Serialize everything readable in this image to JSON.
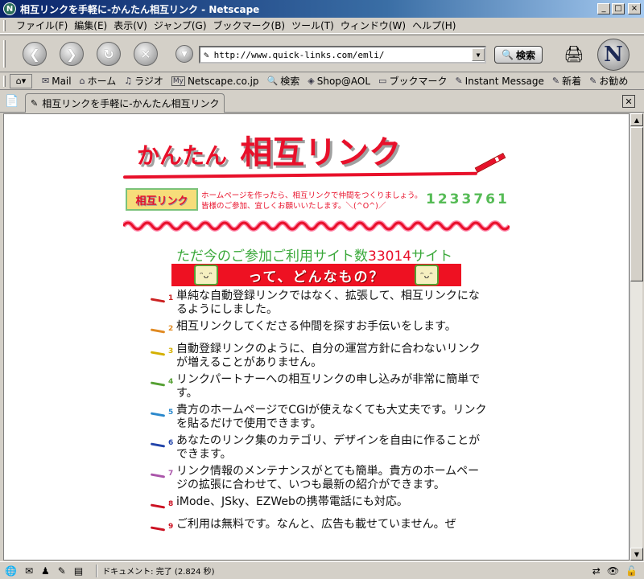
{
  "window": {
    "title": "相互リンクを手軽に-かんたん相互リンク - Netscape",
    "app_icon": "N",
    "min": "_",
    "max": "□",
    "close": "×"
  },
  "menu": [
    "ファイル(F)",
    "編集(E)",
    "表示(V)",
    "ジャンプ(G)",
    "ブックマーク(B)",
    "ツール(T)",
    "ウィンドウ(W)",
    "ヘルプ(H)"
  ],
  "nav": {
    "url": "http://www.quick-links.com/emli/",
    "search_label": "検索",
    "logo": "N"
  },
  "personal_toolbar": [
    {
      "icon": "✉",
      "label": "Mail"
    },
    {
      "icon": "⌂",
      "label": "ホーム"
    },
    {
      "icon": "♫",
      "label": "ラジオ"
    },
    {
      "icon": "My",
      "label": "Netscape.co.jp"
    },
    {
      "icon": "🔍",
      "label": "検索"
    },
    {
      "icon": "◈",
      "label": "Shop@AOL"
    },
    {
      "icon": "▭",
      "label": "ブックマーク"
    },
    {
      "icon": "✎",
      "label": "Instant Message"
    },
    {
      "icon": "✎",
      "label": "新着"
    },
    {
      "icon": "✎",
      "label": "お勧め"
    }
  ],
  "tab": {
    "title": "相互リンクを手軽に-かんたん相互リンク"
  },
  "page": {
    "title_small": "かんたん",
    "title_big": "相互リンク",
    "mini_logo": "相互リンク",
    "intro": "ホームページを作ったら、相互リンクで仲間をつくりましょう。皆様のご参加、宜しくお願いいたします。＼(^O^)／",
    "counter": "1233761",
    "count_prefix": "ただ今のご参加ご利用サイト数",
    "count_number": "33014",
    "count_suffix": "サイト",
    "banner": "って、どんなもの？",
    "features": [
      {
        "n": "1",
        "color": "#cc2222",
        "text": "単純な自動登録リンクではなく、拡張して、相互リンクになるようにしました。"
      },
      {
        "n": "2",
        "color": "#e08a22",
        "text": "相互リンクしてくださる仲間を探すお手伝いをします。"
      },
      {
        "n": "3",
        "color": "#d4b000",
        "text": "自動登録リンクのように、自分の運営方針に合わないリンクが増えることがありません。"
      },
      {
        "n": "4",
        "color": "#55a033",
        "text": "リンクパートナーへの相互リンクの申し込みが非常に簡単です。"
      },
      {
        "n": "5",
        "color": "#2a88cc",
        "text": "貴方のホームページでCGIが使えなくても大丈夫です。リンクを貼るだけで使用できます。"
      },
      {
        "n": "6",
        "color": "#2244aa",
        "text": "あなたのリンク集のカテゴリ、デザインを自由に作ることができます。"
      },
      {
        "n": "7",
        "color": "#aa55aa",
        "text": "リンク情報のメンテナンスがとても簡単。貴方のホームページの拡張に合わせて、いつも最新の紹介ができます。"
      },
      {
        "n": "8",
        "color": "#cc1122",
        "text": "iMode、JSky、EZWebの携帯電話にも対応。"
      },
      {
        "n": "9",
        "color": "#cc1122",
        "text": "ご利用は無料です。なんと、広告も載せていません。ぜ"
      }
    ]
  },
  "status": {
    "text": "ドキュメント: 完了 (2.824 秒)"
  }
}
